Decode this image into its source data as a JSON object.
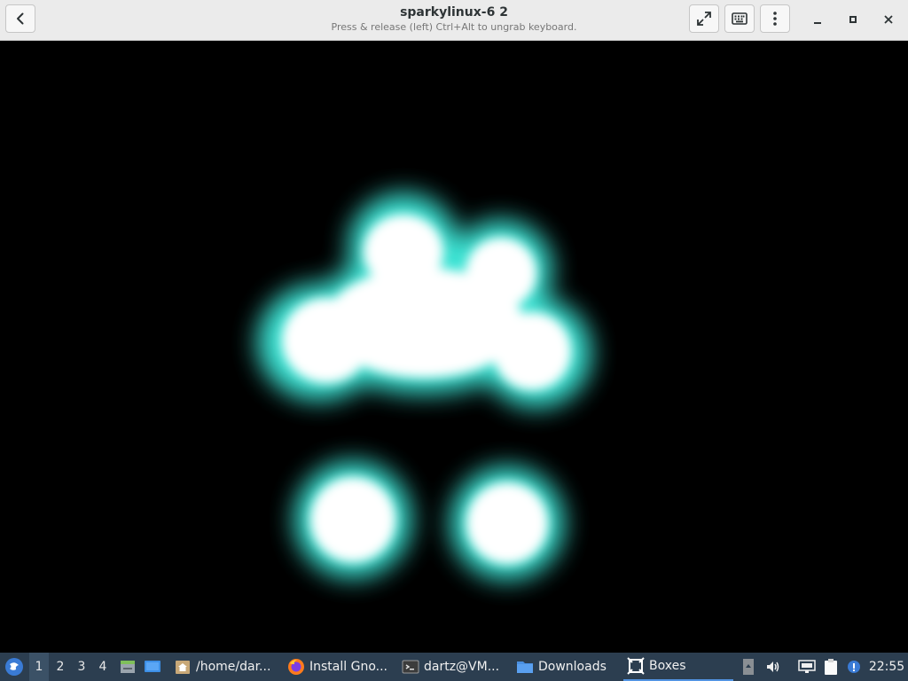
{
  "window": {
    "title": "sparkylinux-6 2",
    "subtitle": "Press & release (left) Ctrl+Alt to ungrab keyboard."
  },
  "header_icons": {
    "back": "back-arrow-icon",
    "fullscreen": "fullscreen-icon",
    "keyboard": "keyboard-icon",
    "menu": "kebab-menu-icon",
    "minimize": "minimize-icon",
    "maximize": "maximize-icon",
    "close": "close-icon"
  },
  "colors": {
    "glow_accent": "#3ff0e0",
    "taskbar_bg": "#2c3e50",
    "active_underline": "#5294e2"
  },
  "taskbar": {
    "workspaces": [
      "1",
      "2",
      "3",
      "4"
    ],
    "active_workspace": "1",
    "tasks": [
      {
        "label": "/home/dar...",
        "icon": "home-folder-icon"
      },
      {
        "label": "Install Gno...",
        "icon": "firefox-icon"
      },
      {
        "label": "dartz@VM...",
        "icon": "terminal-icon"
      },
      {
        "label": "Downloads",
        "icon": "folder-icon"
      },
      {
        "label": "Boxes",
        "icon": "boxes-icon",
        "active": true
      }
    ],
    "clock": "22:55"
  }
}
